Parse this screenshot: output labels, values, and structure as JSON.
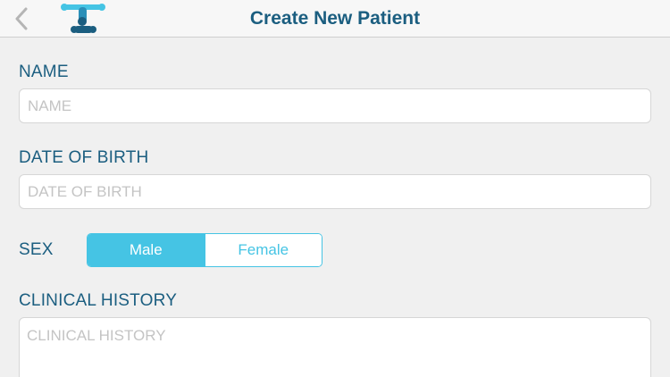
{
  "colors": {
    "primary_text": "#1b5e80",
    "accent": "#45c4e4",
    "background": "#f0f0f0",
    "navbar_bg": "#f7f7f7",
    "logo_dark": "#1b5e80",
    "logo_light": "#45c4e4"
  },
  "navbar": {
    "back_icon": "chevron-left-icon",
    "logo_icon": "app-logo-icon",
    "title": "Create New Patient"
  },
  "form": {
    "name": {
      "label": "NAME",
      "placeholder": "NAME",
      "value": ""
    },
    "dob": {
      "label": "DATE OF BIRTH",
      "placeholder": "DATE OF BIRTH",
      "value": ""
    },
    "sex": {
      "label": "SEX",
      "options": [
        "Male",
        "Female"
      ],
      "selected": "Male"
    },
    "clinical_history": {
      "label": "CLINICAL HISTORY",
      "placeholder": "CLINICAL HISTORY",
      "value": ""
    }
  }
}
